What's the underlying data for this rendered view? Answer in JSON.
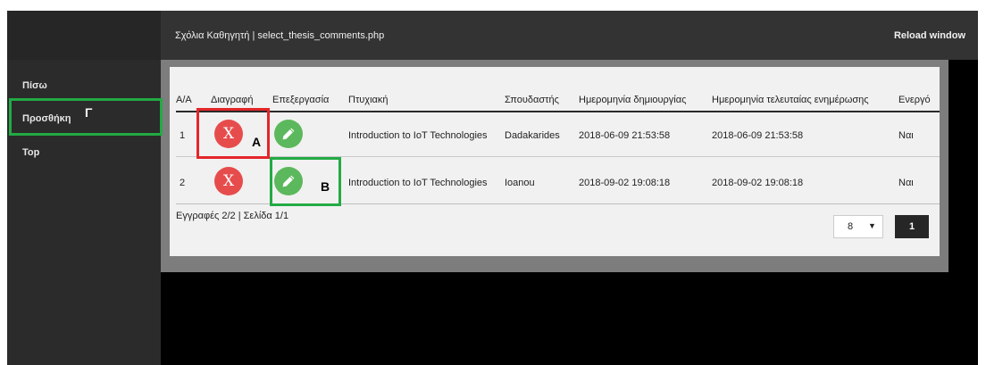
{
  "header": {
    "title": "Σχόλια Καθηγητή | select_thesis_comments.php",
    "reload": "Reload window"
  },
  "sidebar": {
    "items": [
      {
        "label": "Πίσω"
      },
      {
        "label": "Προσθήκη"
      },
      {
        "label": "Top"
      }
    ]
  },
  "table": {
    "columns": [
      "Α/Α",
      "Διαγραφή",
      "Επεξεργασία",
      "Πτυχιακή",
      "Σπουδαστής",
      "Ημερομηνία δημιουργίας",
      "Ημερομηνία τελευταίας ενημέρωσης",
      "Ενεργό"
    ],
    "delete_glyph": "X",
    "delete_icon": "x-circle-icon",
    "edit_icon": "pencil-icon",
    "rows": [
      {
        "aa": "1",
        "thesis": "Introduction to IoT Technologies",
        "student": "Dadakarides",
        "created": "2018-06-09 21:53:58",
        "updated": "2018-06-09 21:53:58",
        "active": "Ναι"
      },
      {
        "aa": "2",
        "thesis": "Introduction to IoT Technologies",
        "student": "Ioanou",
        "created": "2018-09-02 19:08:18",
        "updated": "2018-09-02 19:08:18",
        "active": "Ναι"
      }
    ]
  },
  "footer": {
    "summary": "Εγγραφές 2/2 | Σελίδα 1/1",
    "page_size": "8",
    "current_page": "1"
  },
  "annotations": {
    "a": "A",
    "b": "B",
    "gamma": "Γ"
  },
  "colors": {
    "annotation_red": "#e3262a",
    "annotation_green": "#22aa44",
    "delete": "#e74c4c",
    "edit": "#5cb85c"
  }
}
